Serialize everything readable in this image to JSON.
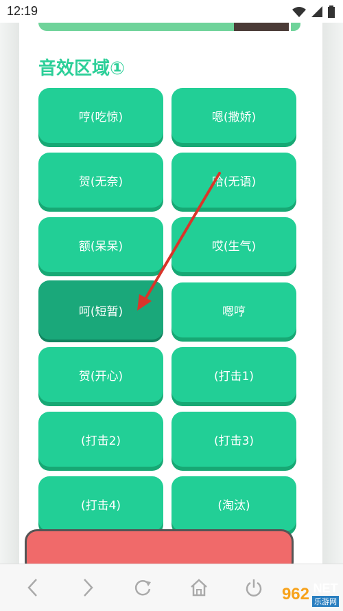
{
  "status_bar": {
    "time": "12:19"
  },
  "section": {
    "title": "音效区域①"
  },
  "buttons": [
    "哼(吃惊)",
    "嗯(撒娇)",
    "贺(无奈)",
    "哈(无语)",
    "额(呆呆)",
    "哎(生气)",
    "呵(短暂)",
    "嗯哼",
    "贺(开心)",
    "(打击1)",
    "(打击2)",
    "(打击3)",
    "(打击4)",
    "(淘汰)"
  ],
  "watermark": {
    "brand": "962",
    "net": "NET",
    "sub": "乐游网"
  },
  "colors": {
    "accent": "#22cf96",
    "active": "#1aa87a",
    "arrow": "#d9352a",
    "red_button": "#f06a6a"
  }
}
